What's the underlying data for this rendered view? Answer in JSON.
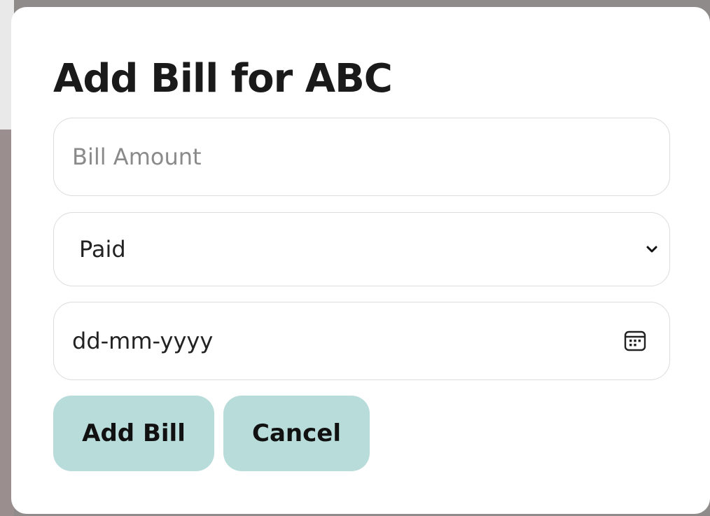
{
  "modal": {
    "title": "Add Bill for ABC",
    "amount_field": {
      "placeholder": "Bill Amount",
      "value": ""
    },
    "status_select": {
      "selected": "Paid",
      "icon": "chevron-down-icon"
    },
    "date_field": {
      "value": "dd-mm-yyyy",
      "icon": "calendar-icon"
    },
    "buttons": {
      "add_label": "Add Bill",
      "cancel_label": "Cancel"
    }
  },
  "colors": {
    "button_bg": "#b8dcda",
    "backdrop": "#8f8b8a",
    "modal_bg": "#ffffff"
  }
}
